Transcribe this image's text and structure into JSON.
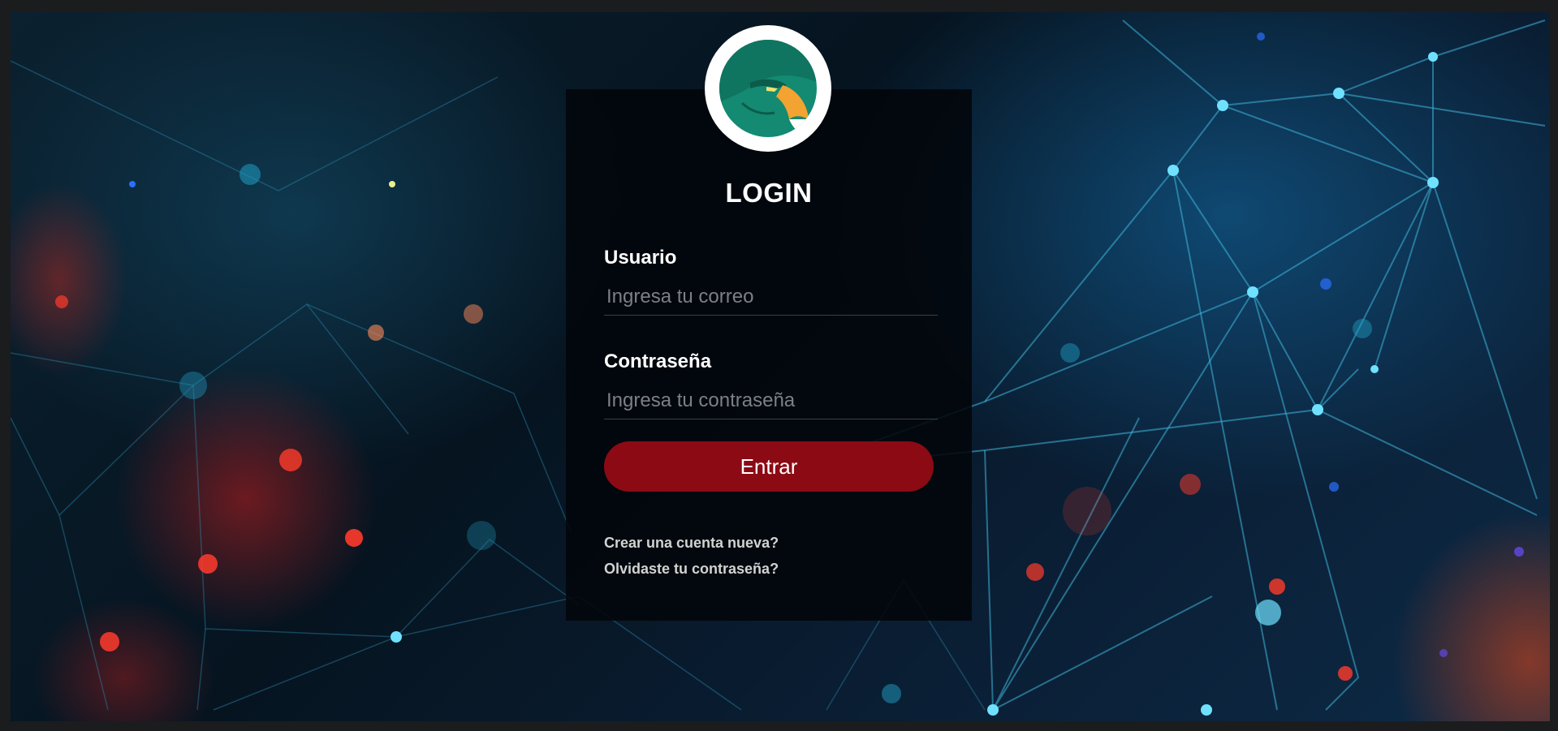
{
  "form": {
    "title": "LOGIN",
    "username_label": "Usuario",
    "username_placeholder": "Ingresa tu correo",
    "username_value": "",
    "password_label": "Contraseña",
    "password_placeholder": "Ingresa tu contraseña",
    "password_value": "",
    "submit_label": "Entrar",
    "create_account_link": "Crear una cuenta nueva?",
    "forgot_password_link": "Olvidaste tu contraseña?"
  },
  "logo": {
    "icon": "eagle-logo-icon"
  },
  "colors": {
    "accent_button": "#8c0a14",
    "logo_ring": "#f28a1c",
    "panel_bg": "#02060a"
  }
}
